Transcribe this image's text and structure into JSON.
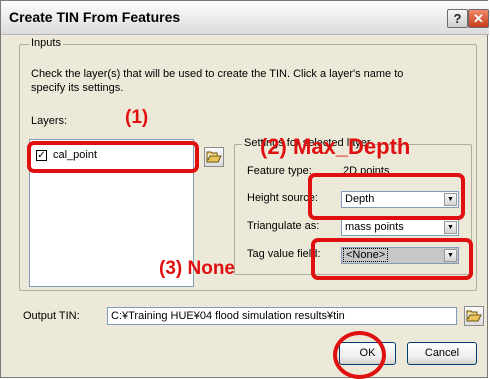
{
  "dialog": {
    "title": "Create TIN From Features",
    "help_label": "?",
    "close_label": "✕"
  },
  "inputs": {
    "legend": "Inputs",
    "instructions_line1": "Check the layer(s) that will be used to create the TIN.  Click a layer's name to",
    "instructions_line2": "specify its settings.",
    "layers_label": "Layers:",
    "layer_items": [
      {
        "label": "cal_point",
        "checked": true
      }
    ]
  },
  "settings": {
    "legend": "Settings for selected layer",
    "feature_type_label": "Feature type:",
    "feature_type_value": "2D points",
    "height_source_label": "Height source:",
    "height_source_value": "Depth",
    "triangulate_label": "Triangulate as:",
    "triangulate_value": "mass points",
    "tag_value_label": "Tag value field:",
    "tag_value_value": "<None>"
  },
  "output": {
    "label": "Output TIN:",
    "value": "C:¥Training HUE¥04 flood simulation results¥tin"
  },
  "buttons": {
    "ok": "OK",
    "cancel": "Cancel"
  },
  "annotations": {
    "a1": "(1)",
    "a2": "(2) Max_Depth",
    "a3": "(3) None",
    "color": "#e01010"
  }
}
